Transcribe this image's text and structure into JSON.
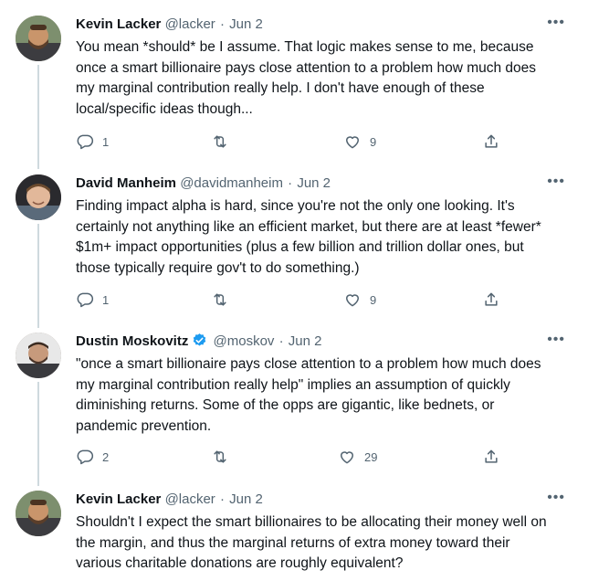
{
  "tweets": [
    {
      "name": "Kevin Lacker",
      "handle": "@lacker",
      "date": "Jun 2",
      "verified": false,
      "text": "You mean *should* be I assume. That logic makes sense to me, because\nonce a smart billionaire pays close attention to a problem how much does\nmy marginal contribution really help. I don't have enough of these\nlocal/specific ideas though...",
      "replies": "1",
      "retweets": "",
      "likes": "9"
    },
    {
      "name": "David Manheim",
      "handle": "@davidmanheim",
      "date": "Jun 2",
      "verified": false,
      "text": "Finding impact alpha is hard, since you're not the only one looking. It's\ncertainly not anything like an efficient market, but there are at least *fewer*\n$1m+ impact opportunities (plus a few billion and trillion dollar ones, but\nthose typically require gov't to do something.)",
      "replies": "1",
      "retweets": "",
      "likes": "9"
    },
    {
      "name": "Dustin Moskovitz",
      "handle": "@moskov",
      "date": "Jun 2",
      "verified": true,
      "text": "\"once a smart billionaire pays close attention to a problem how much does\nmy marginal contribution really help\" implies an assumption of quickly\ndiminishing returns. Some of the opps are gigantic, like bednets, or\npandemic prevention.",
      "replies": "2",
      "retweets": "",
      "likes": "29"
    },
    {
      "name": "Kevin Lacker",
      "handle": "@lacker",
      "date": "Jun 2",
      "verified": false,
      "text": "Shouldn't I expect the smart billionaires to be allocating their money well on\nthe margin, and thus the marginal returns of extra money toward their\nvarious charitable donations are roughly equivalent?",
      "replies": "",
      "retweets": "",
      "likes": ""
    }
  ],
  "separator": "·",
  "more_glyph": "•••",
  "colors": {
    "text": "#0f1419",
    "secondary": "#536471",
    "thread_line": "#cfd9de",
    "verified": "#1d9bf0"
  },
  "icons": {
    "reply": "reply-icon",
    "retweet": "retweet-icon",
    "like": "like-icon",
    "share": "share-icon",
    "more": "more-icon",
    "verified": "verified-badge-icon"
  }
}
